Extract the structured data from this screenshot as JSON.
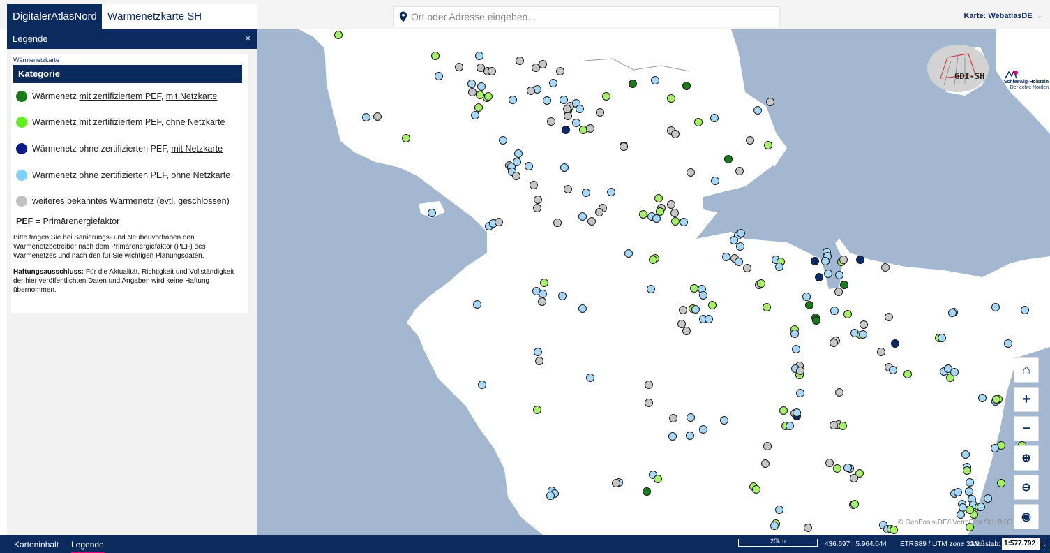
{
  "header": {
    "brand": "DigitalerAtlasNord",
    "app_title": "Wärmenetzkarte SH",
    "search_placeholder": "Ort oder Adresse eingeben...",
    "map_label": "Karte:",
    "map_value": "WebatlasDE",
    "chevron": "⌄"
  },
  "legend_panel": {
    "title": "Legende",
    "close": "×",
    "layer_title": "Wärmenetzkarte",
    "category_header": "Kategorie",
    "items": [
      {
        "color": "#1a7a1a",
        "p1": "Wärmenetz ",
        "u1": "mit zertifiziertem PEF",
        "p2": ", ",
        "u2": "mit Netzkarte",
        "p3": ""
      },
      {
        "color": "#66ee22",
        "p1": "Wärmenetz ",
        "u1": "mit zertifiziertem PEF",
        "p2": ", ohne Netzkarte",
        "u2": "",
        "p3": ""
      },
      {
        "color": "#0a1a8a",
        "p1": "Wärmenetz ohne zertifizierten PEF, ",
        "u1": "",
        "p2": "",
        "u2": "mit Netzkarte",
        "p3": ""
      },
      {
        "color": "#7fcfff",
        "p1": "Wärmenetz ohne zertifizierten PEF, ohne Netzkarte",
        "u1": "",
        "p2": "",
        "u2": "",
        "p3": ""
      },
      {
        "color": "#c2c2c2",
        "p1": "weiteres bekanntes Wärmenetz (evtl. geschlossen)",
        "u1": "",
        "p2": "",
        "u2": "",
        "p3": ""
      }
    ],
    "pef_abbr": "PEF",
    "pef_def": " = Primärenergiefaktor",
    "info": "Bitte fragen Sie bei Sanierungs- und Neubauvorhaben den Wärmenetzbetreiber nach dem Primärenergiefaktor (PEF) des Wärmenetzes und nach den für Sie wichtigen Planungsdaten.",
    "disclaimer_label": "Haftungsausschluss:",
    "disclaimer": " Für die Aktualität, Richtigkeit und Vollständigkeit der hier veröffentlichten Daten und Angaben wird keine Haftung übernommen."
  },
  "map": {
    "attribution": "© GeoBasis-DE/LVermGeo SH, BKG",
    "logo_text": "GDI-SH",
    "sh_logo_line1": "Schleswig-Holstein",
    "sh_logo_line2": "Der echte Norden",
    "colors": {
      "water": "#a3b8d0",
      "land": "#ffffff",
      "dark_green": "#1a7a1a",
      "light_green": "#a6ef6a",
      "dark_blue": "#0b2a6e",
      "light_blue": "#a7d8fb",
      "gray": "#c6c6c6"
    },
    "controls": [
      {
        "name": "home-button",
        "icon": "⌂"
      },
      {
        "name": "zoom-in-button",
        "icon": "+"
      },
      {
        "name": "zoom-out-button",
        "icon": "−"
      },
      {
        "name": "zoom-box-in-button",
        "icon": "⊕"
      },
      {
        "name": "zoom-box-out-button",
        "icon": "⊖"
      },
      {
        "name": "globe-button",
        "icon": "◉"
      }
    ]
  },
  "footer": {
    "tab_content": "Karteninhalt",
    "tab_legend": "Legende",
    "scale_distance": "20km",
    "coordinates": "436.697 : 5.964.044",
    "crs": "ETRS89 / UTM zone 32N",
    "scale_label": "Maßstab:",
    "scale_value": "1:577.792",
    "chevron": "⌄"
  }
}
